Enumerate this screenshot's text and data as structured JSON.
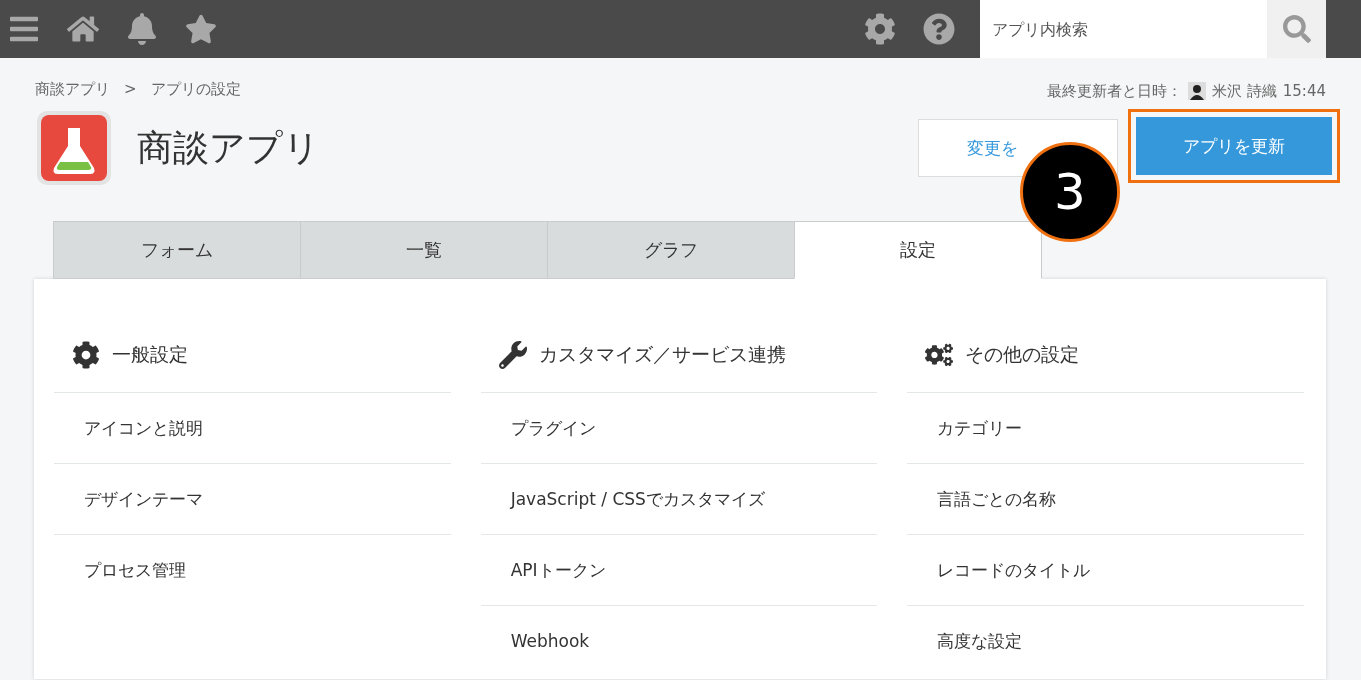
{
  "search": {
    "placeholder": "アプリ内検索"
  },
  "breadcrumb": [
    {
      "label": "商談アプリ"
    },
    {
      "label": ">"
    },
    {
      "label": "アプリの設定"
    }
  ],
  "last_updated": {
    "label": "最終更新者と日時：",
    "user": "米沢 詩織",
    "time": "15:44"
  },
  "app": {
    "title": "商談アプリ"
  },
  "buttons": [
    {
      "kind": "cancel",
      "label": "変更を"
    },
    {
      "kind": "update",
      "label": "アプリを更新",
      "highlighted": true
    }
  ],
  "callout": {
    "label": "3"
  },
  "tabs": [
    {
      "label": "フォーム",
      "selected": false
    },
    {
      "label": "一覧",
      "selected": false
    },
    {
      "label": "グラフ",
      "selected": false
    },
    {
      "label": "設定",
      "selected": true
    }
  ],
  "columns": [
    {
      "kind": "gear",
      "heading": "一般設定",
      "items": [
        "アイコンと説明",
        "デザインテーマ",
        "プロセス管理"
      ]
    },
    {
      "kind": "wrench",
      "heading": "カスタマイズ／サービス連携",
      "items": [
        "プラグイン",
        "JavaScript / CSSでカスタマイズ",
        "APIトークン",
        "Webhook"
      ]
    },
    {
      "kind": "gears",
      "heading": "その他の設定",
      "items": [
        "カテゴリー",
        "言語ごとの名称",
        "レコードのタイトル",
        "高度な設定"
      ]
    }
  ]
}
